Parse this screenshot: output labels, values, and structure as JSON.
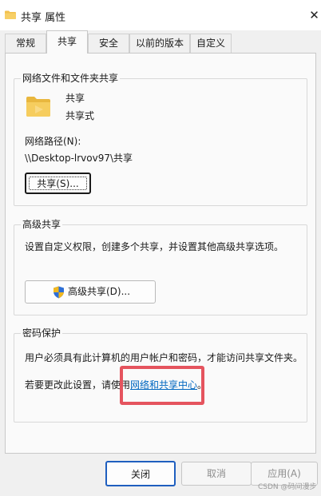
{
  "window": {
    "title": "共享 属性",
    "close_glyph": "✕"
  },
  "tabs": [
    {
      "label": "常规"
    },
    {
      "label": "共享",
      "active": true
    },
    {
      "label": "安全"
    },
    {
      "label": "以前的版本"
    },
    {
      "label": "自定义"
    }
  ],
  "network_share": {
    "legend": "网络文件和文件夹共享",
    "name": "共享",
    "status": "共享式",
    "path_label": "网络路径(N):",
    "path_value": "\\\\Desktop-lrvov97\\共享",
    "share_button": "共享(S)..."
  },
  "advanced_share": {
    "legend": "高级共享",
    "description": "设置自定义权限，创建多个共享，并设置其他高级共享选项。",
    "button": "高级共享(D)...",
    "button_icon": "uac-shield-icon"
  },
  "password_protection": {
    "legend": "密码保护",
    "description": "用户必须具有此计算机的用户帐户和密码，才能访问共享文件夹。",
    "change_prefix": "若要更改此设置，请使用",
    "link_text": "网络和共享中心",
    "change_suffix": "。"
  },
  "footer": {
    "ok": "关闭",
    "cancel": "取消",
    "apply": "应用(A)"
  },
  "watermark": "CSDN @码间漫步",
  "colors": {
    "link": "#0067c0",
    "highlight_border": "#e5545e",
    "folder": "#f2c14e"
  }
}
